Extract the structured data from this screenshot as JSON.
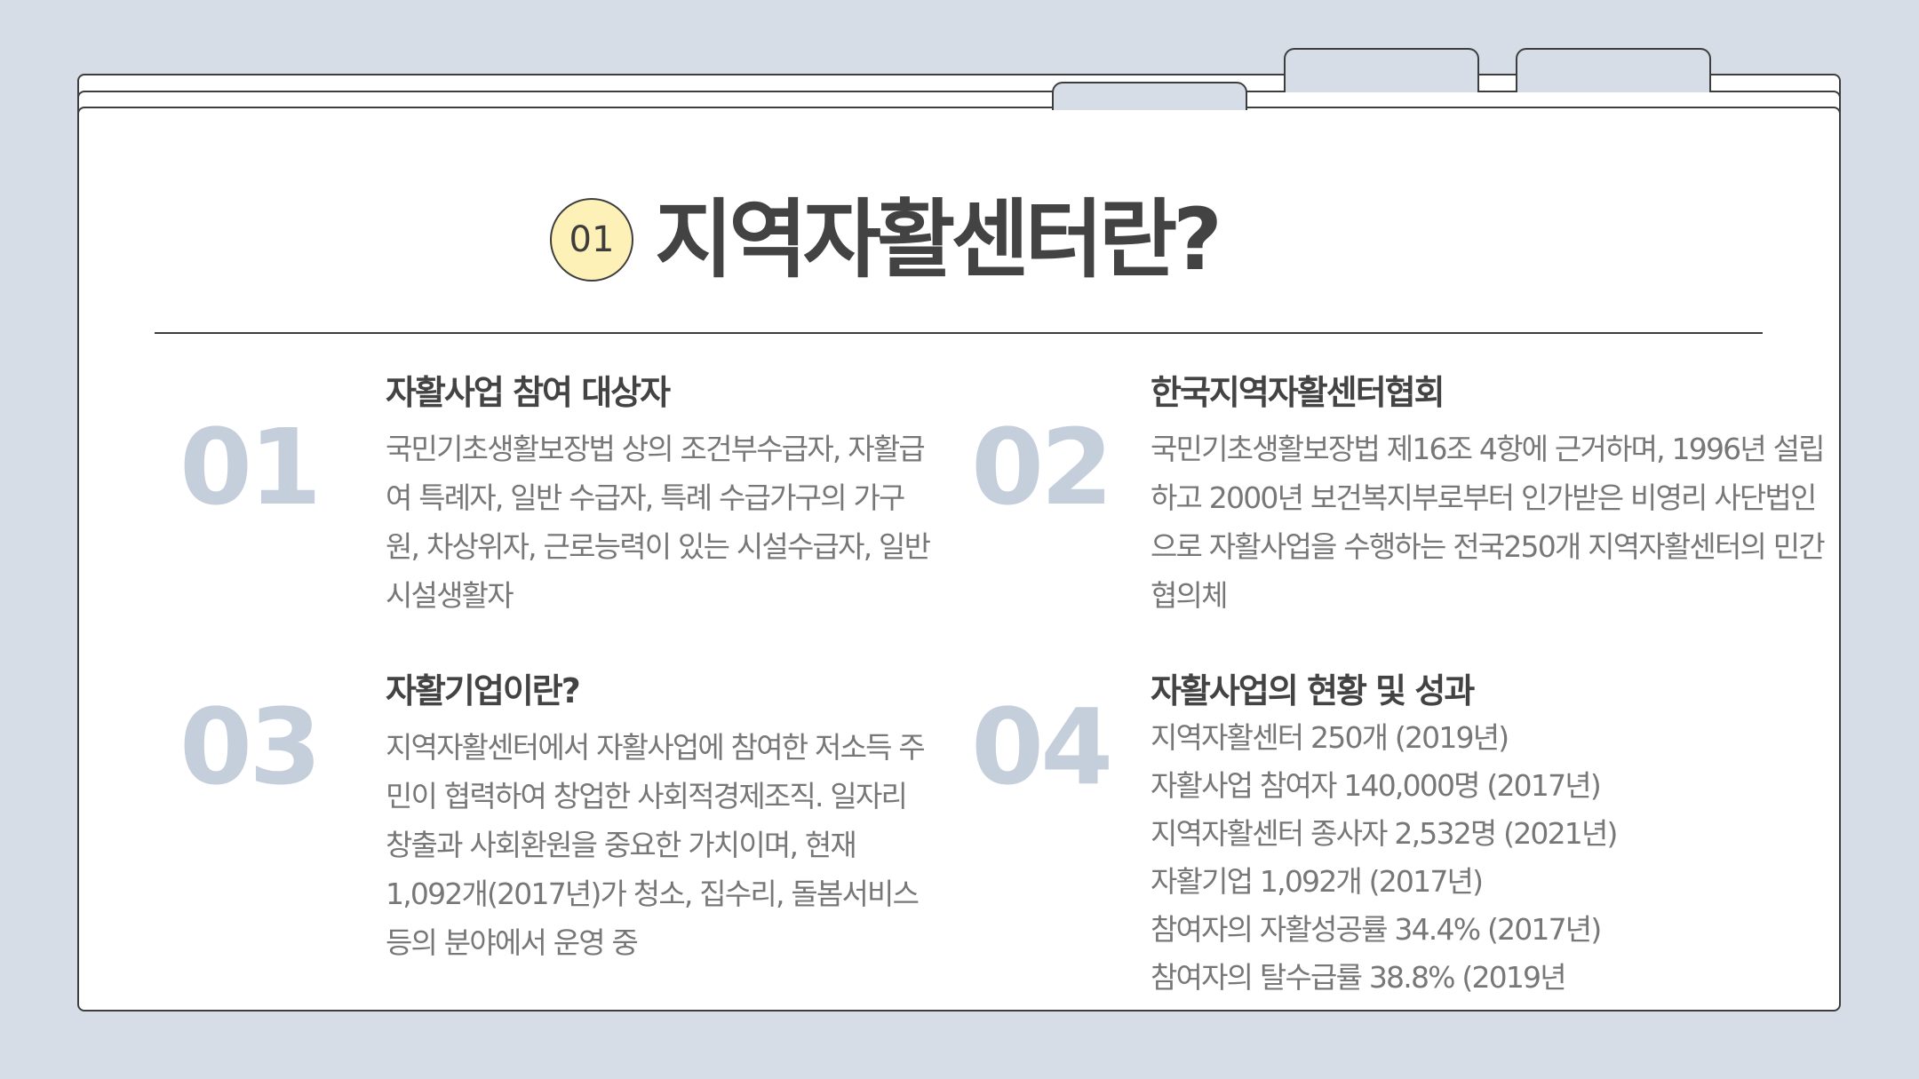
{
  "header": {
    "badge": "01",
    "title": "지역자활센터란?"
  },
  "sections": [
    {
      "number": "01",
      "title": "자활사업 참여 대상자",
      "body": "국민기초생활보장법 상의 조건부수급자, 자활급여 특례자, 일반 수급자, 특례 수급가구의 가구원, 차상위자, 근로능력이 있는 시설수급자, 일반시설생활자"
    },
    {
      "number": "02",
      "title": "한국지역자활센터협회",
      "body": "국민기초생활보장법 제16조 4항에 근거하며, 1996년 설립하고 2000년 보건복지부로부터 인가받은 비영리 사단법인으로 자활사업을 수행하는 전국250개 지역자활센터의 민간 협의체"
    },
    {
      "number": "03",
      "title": "자활기업이란?",
      "body": "지역자활센터에서 자활사업에 참여한 저소득 주민이 협력하여 창업한 사회적경제조직. 일자리 창출과 사회환원을 중요한 가치이며, 현재 1,092개(2017년)가 청소, 집수리, 돌봄서비스 등의 분야에서 운영 중"
    },
    {
      "number": "04",
      "title": "자활사업의 현황 및 성과",
      "items": [
        "지역자활센터 250개 (2019년)",
        "자활사업 참여자 140,000명 (2017년)",
        "지역자활센터 종사자 2,532명 (2021년)",
        "자활기업 1,092개 (2017년)",
        "참여자의 자활성공률 34.4% (2017년)",
        "참여자의 탈수급률 38.8% (2019년"
      ]
    }
  ],
  "colors": {
    "background": "#d6dde6",
    "badge_fill": "#fdf1b8",
    "number_accent": "#c5cfdc",
    "ink": "#434343",
    "body_text": "#777777"
  }
}
